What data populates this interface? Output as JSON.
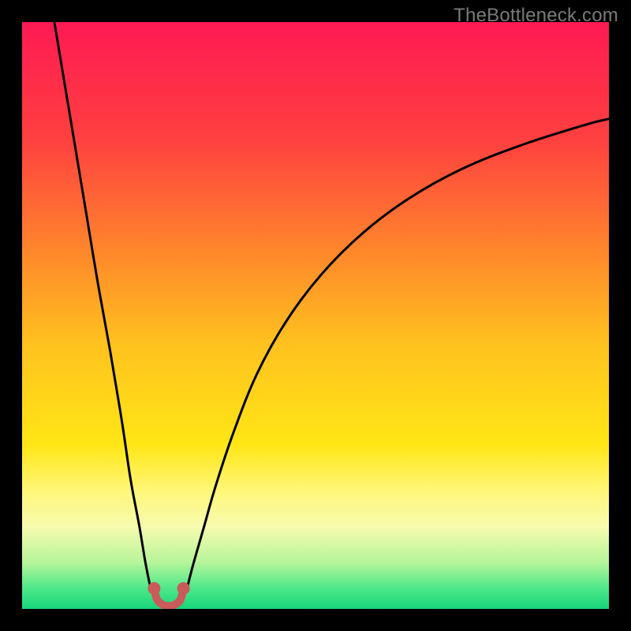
{
  "watermark": "TheBottleneck.com",
  "chart_data": {
    "type": "line",
    "title": "",
    "xlabel": "",
    "ylabel": "",
    "xlim": [
      0,
      100
    ],
    "ylim": [
      0,
      100
    ],
    "background_gradient": [
      {
        "stop": 0.0,
        "color": "#ff1a53"
      },
      {
        "stop": 0.2,
        "color": "#ff4040"
      },
      {
        "stop": 0.4,
        "color": "#ff8a2a"
      },
      {
        "stop": 0.55,
        "color": "#ffc21f"
      },
      {
        "stop": 0.72,
        "color": "#ffe615"
      },
      {
        "stop": 0.8,
        "color": "#fff77a"
      },
      {
        "stop": 0.86,
        "color": "#f7fbb0"
      },
      {
        "stop": 0.92,
        "color": "#b7f59a"
      },
      {
        "stop": 0.965,
        "color": "#4de88a"
      },
      {
        "stop": 1.0,
        "color": "#18d47a"
      }
    ],
    "series": [
      {
        "name": "left-branch",
        "color": "#000000",
        "x": [
          5.5,
          7,
          9,
          11,
          13,
          15,
          17,
          18.5,
          20,
          21,
          22
        ],
        "y": [
          100,
          91,
          79,
          67,
          55,
          44,
          32,
          22,
          14,
          8,
          3
        ]
      },
      {
        "name": "right-branch",
        "color": "#000000",
        "x": [
          28,
          29,
          31,
          33,
          36,
          40,
          45,
          51,
          58,
          66,
          75,
          85,
          96,
          100
        ],
        "y": [
          3,
          7,
          14,
          21,
          30,
          40,
          49,
          57,
          64,
          70,
          75,
          79,
          82.5,
          83.5
        ]
      },
      {
        "name": "trough-marker",
        "color": "#c95b5b",
        "marker_x": [
          22.5,
          27.5
        ],
        "marker_y": [
          3.5,
          3.5
        ],
        "path_x": [
          22.5,
          23,
          24,
          25,
          26,
          27,
          27.5
        ],
        "path_y": [
          3.5,
          1.6,
          0.7,
          0.5,
          0.7,
          1.6,
          3.5
        ]
      }
    ]
  }
}
